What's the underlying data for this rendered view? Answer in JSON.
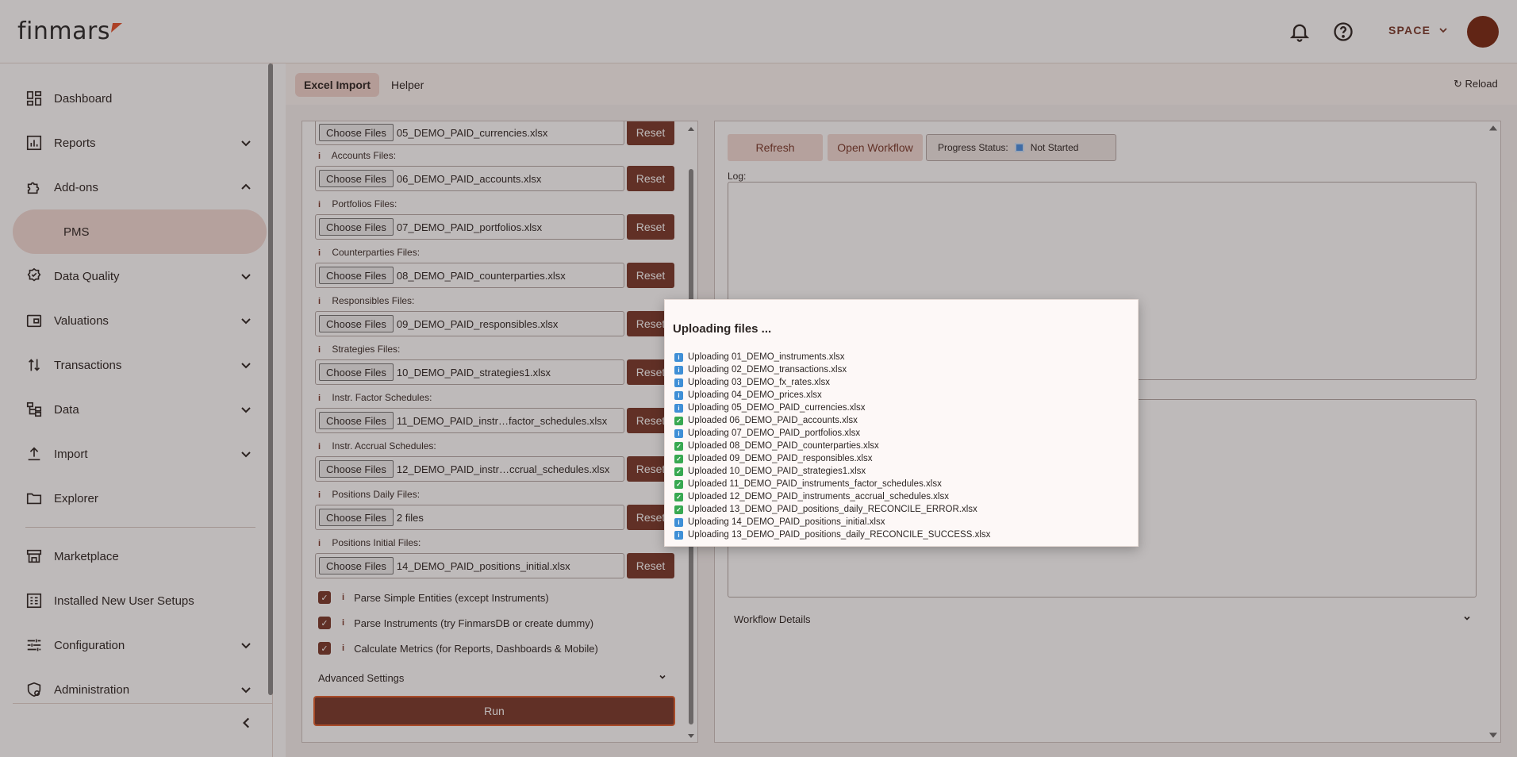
{
  "app": {
    "brand": "finmars",
    "space_label": "SPACE",
    "accent": "#7a3a2b",
    "avatar_color": "#7a2a14"
  },
  "header": {
    "notifications_icon": "bell-icon",
    "help_icon": "help-circle-icon"
  },
  "sidebar": {
    "items": [
      {
        "label": "Dashboard",
        "icon": "dashboard-grid-icon"
      },
      {
        "label": "Reports",
        "icon": "bar-chart-icon"
      },
      {
        "label": "Add-ons",
        "icon": "puzzle-icon"
      },
      {
        "label": "PMS"
      },
      {
        "label": "Data Quality",
        "icon": "badge-check-icon"
      },
      {
        "label": "Valuations",
        "icon": "wallet-icon"
      },
      {
        "label": "Transactions",
        "icon": "arrows-updown-icon"
      },
      {
        "label": "Data",
        "icon": "tree-structure-icon"
      },
      {
        "label": "Import",
        "icon": "upload-icon"
      },
      {
        "label": "Explorer",
        "icon": "folder-icon"
      },
      {
        "label": "Marketplace",
        "icon": "store-icon"
      },
      {
        "label": "Installed New User Setups",
        "icon": "list-box-icon"
      },
      {
        "label": "Configuration",
        "icon": "sliders-icon"
      },
      {
        "label": "Administration",
        "icon": "shield-gear-icon"
      }
    ]
  },
  "tabs": [
    {
      "label": "Excel Import",
      "active": true
    },
    {
      "label": "Helper",
      "active": false
    }
  ],
  "reload_label": "↻ Reload",
  "import_form": {
    "choose_label": "Choose Files",
    "reset_label": "Reset",
    "rows": [
      {
        "label": "",
        "file": "05_DEMO_PAID_currencies.xlsx"
      },
      {
        "label": "Accounts Files:",
        "file": "06_DEMO_PAID_accounts.xlsx"
      },
      {
        "label": "Portfolios Files:",
        "file": "07_DEMO_PAID_portfolios.xlsx"
      },
      {
        "label": "Counterparties Files:",
        "file": "08_DEMO_PAID_counterparties.xlsx"
      },
      {
        "label": "Responsibles Files:",
        "file": "09_DEMO_PAID_responsibles.xlsx"
      },
      {
        "label": "Strategies Files:",
        "file": "10_DEMO_PAID_strategies1.xlsx"
      },
      {
        "label": "Instr. Factor Schedules:",
        "file": "11_DEMO_PAID_instr…factor_schedules.xlsx"
      },
      {
        "label": "Instr. Accrual Schedules:",
        "file": "12_DEMO_PAID_instr…ccrual_schedules.xlsx"
      },
      {
        "label": "Positions Daily Files:",
        "file": "2 files"
      },
      {
        "label": "Positions Initial Files:",
        "file": "14_DEMO_PAID_positions_initial.xlsx"
      }
    ],
    "checks": [
      {
        "label": "Parse Simple Entities (except Instruments)",
        "checked": true
      },
      {
        "label": "Parse Instruments (try FinmarsDB or create dummy)",
        "checked": true
      },
      {
        "label": "Calculate Metrics (for Reports, Dashboards & Mobile)",
        "checked": true
      }
    ],
    "advanced_label": "Advanced Settings",
    "run_label": "Run"
  },
  "workflow": {
    "refresh_label": "Refresh",
    "open_workflow_label": "Open Workflow",
    "progress_label": "Progress Status:",
    "progress_value": "Not Started",
    "log_label": "Log:",
    "details_label": "Workflow Details"
  },
  "modal": {
    "title": "Uploading files ...",
    "items": [
      {
        "status": "info",
        "text": "Uploading 01_DEMO_instruments.xlsx"
      },
      {
        "status": "info",
        "text": "Uploading 02_DEMO_transactions.xlsx"
      },
      {
        "status": "info",
        "text": "Uploading 03_DEMO_fx_rates.xlsx"
      },
      {
        "status": "info",
        "text": "Uploading 04_DEMO_prices.xlsx"
      },
      {
        "status": "info",
        "text": "Uploading 05_DEMO_PAID_currencies.xlsx"
      },
      {
        "status": "ok",
        "text": "Uploaded 06_DEMO_PAID_accounts.xlsx"
      },
      {
        "status": "info",
        "text": "Uploading 07_DEMO_PAID_portfolios.xlsx"
      },
      {
        "status": "ok",
        "text": "Uploaded 08_DEMO_PAID_counterparties.xlsx"
      },
      {
        "status": "ok",
        "text": "Uploaded 09_DEMO_PAID_responsibles.xlsx"
      },
      {
        "status": "ok",
        "text": "Uploaded 10_DEMO_PAID_strategies1.xlsx"
      },
      {
        "status": "ok",
        "text": "Uploaded 11_DEMO_PAID_instruments_factor_schedules.xlsx"
      },
      {
        "status": "ok",
        "text": "Uploaded 12_DEMO_PAID_instruments_accrual_schedules.xlsx"
      },
      {
        "status": "ok",
        "text": "Uploaded 13_DEMO_PAID_positions_daily_RECONCILE_ERROR.xlsx"
      },
      {
        "status": "info",
        "text": "Uploading 14_DEMO_PAID_positions_initial.xlsx"
      },
      {
        "status": "info",
        "text": "Uploading 13_DEMO_PAID_positions_daily_RECONCILE_SUCCESS.xlsx"
      }
    ]
  }
}
